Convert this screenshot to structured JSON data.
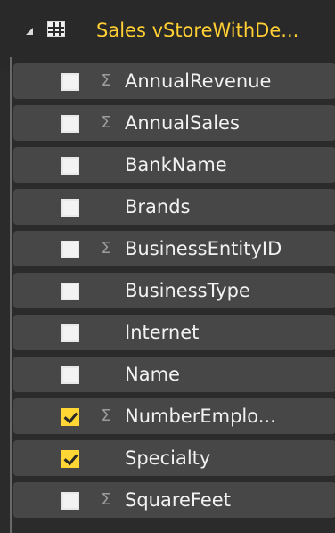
{
  "table": {
    "title": "Sales vStoreWithDe...",
    "icon": "table-icon",
    "collapse_icon": "collapse-triangle-icon",
    "accent_color": "#ffcf33"
  },
  "fields": [
    {
      "label": "AnnualRevenue",
      "checked": false,
      "aggregate_icon": "sigma-icon"
    },
    {
      "label": "AnnualSales",
      "checked": false,
      "aggregate_icon": "sigma-icon"
    },
    {
      "label": "BankName",
      "checked": false,
      "aggregate_icon": ""
    },
    {
      "label": "Brands",
      "checked": false,
      "aggregate_icon": ""
    },
    {
      "label": "BusinessEntityID",
      "checked": false,
      "aggregate_icon": "sigma-icon"
    },
    {
      "label": "BusinessType",
      "checked": false,
      "aggregate_icon": ""
    },
    {
      "label": "Internet",
      "checked": false,
      "aggregate_icon": ""
    },
    {
      "label": "Name",
      "checked": false,
      "aggregate_icon": ""
    },
    {
      "label": "NumberEmplo...",
      "checked": true,
      "aggregate_icon": "sigma-icon"
    },
    {
      "label": "Specialty",
      "checked": true,
      "aggregate_icon": ""
    },
    {
      "label": "SquareFeet",
      "checked": false,
      "aggregate_icon": "sigma-icon"
    }
  ],
  "symbols": {
    "sigma": "Σ"
  },
  "colors": {
    "background": "#2b2b2b",
    "row": "#474747",
    "checked": "#ffd633",
    "unchecked": "#f3f3f3"
  }
}
